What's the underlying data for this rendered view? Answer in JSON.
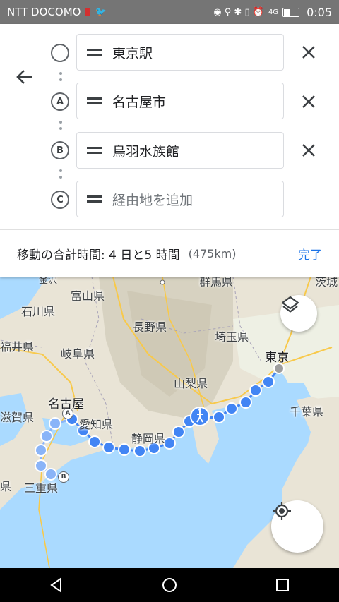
{
  "status_bar": {
    "carrier": "NTT DOCOMO",
    "network": "4G",
    "time": "0:05"
  },
  "waypoints": [
    {
      "marker": "",
      "value": "東京駅",
      "placeholder": false
    },
    {
      "marker": "A",
      "value": "名古屋市",
      "placeholder": false
    },
    {
      "marker": "B",
      "value": "鳥羽水族館",
      "placeholder": false
    },
    {
      "marker": "C",
      "value": "経由地を追加",
      "placeholder": true
    }
  ],
  "summary": {
    "duration": "移動の合計時間: 4 日と5 時間",
    "distance": "(475km)",
    "done_label": "完了"
  },
  "map": {
    "labels": {
      "kanazawa": "金沢",
      "toyama": "富山県",
      "ishikawa": "石川県",
      "fukui": "福井県",
      "gifu": "岐阜県",
      "nagano": "長野県",
      "gunma": "群馬県",
      "ibaraki": "茨城",
      "saitama": "埼玉県",
      "yamanashi": "山梨県",
      "tokyo": "東京",
      "nagoya": "名古屋",
      "aichi": "愛知県",
      "shizuoka": "静岡県",
      "chiba": "千葉県",
      "shiga": "滋賀県",
      "mie": "三重県",
      "ken": "県"
    },
    "route_color": "#4285f4",
    "markers": {
      "a": "A",
      "b": "B"
    }
  }
}
